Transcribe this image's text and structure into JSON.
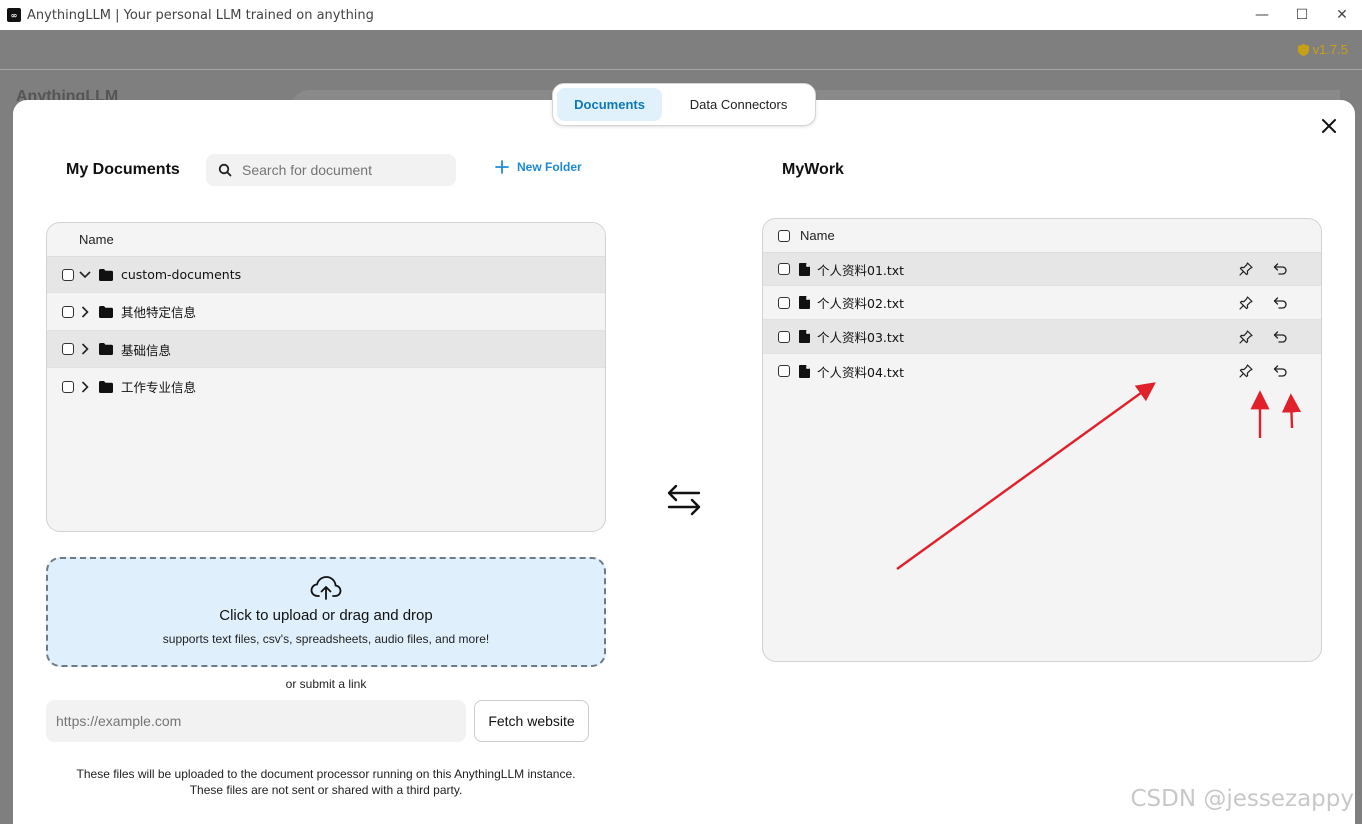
{
  "window": {
    "title": "AnythingLLM | Your personal LLM trained on anything",
    "logo_glyph": "∞",
    "minimize": "—",
    "maximize": "☐",
    "close": "✕"
  },
  "app": {
    "version": "v1.7.5",
    "background_title": "AnythingLLM"
  },
  "tabs": [
    {
      "label": "Documents",
      "active": true
    },
    {
      "label": "Data Connectors",
      "active": false
    }
  ],
  "my_documents": {
    "title": "My Documents",
    "search_placeholder": "Search for document",
    "new_folder_label": "New Folder",
    "column_name": "Name",
    "folders": [
      {
        "name": "custom-documents",
        "expanded": true
      },
      {
        "name": "其他特定信息",
        "expanded": false
      },
      {
        "name": "基础信息",
        "expanded": false
      },
      {
        "name": "工作专业信息",
        "expanded": false
      }
    ]
  },
  "upload": {
    "main_text": "Click to upload or drag and drop",
    "sub_text": "supports text files, csv's, spreadsheets, audio files, and more!",
    "or_link": "or submit a link",
    "url_placeholder": "https://example.com",
    "fetch_label": "Fetch website",
    "footer_line1": "These files will be uploaded to the document processor running on this AnythingLLM instance.",
    "footer_line2": "These files are not sent or shared with a third party."
  },
  "workspace": {
    "title": "MyWork",
    "column_name": "Name",
    "files": [
      {
        "name": "个人资料01.txt"
      },
      {
        "name": "个人资料02.txt"
      },
      {
        "name": "个人资料03.txt"
      },
      {
        "name": "个人资料04.txt"
      }
    ]
  },
  "watermark": "CSDN @jessezappy",
  "colors": {
    "accent": "#0f79b8",
    "link": "#1d8ad6",
    "upload_bg": "#dff0fc",
    "annotation_arrow": "#e0202a",
    "version": "#c9a014"
  },
  "icons": [
    "search-icon",
    "plus-icon",
    "folder-icon",
    "file-icon",
    "pin-icon",
    "undo-icon",
    "upload-cloud-icon",
    "swap-arrows-icon",
    "close-icon",
    "chevron-down-icon",
    "chevron-right-icon",
    "shield-icon"
  ]
}
